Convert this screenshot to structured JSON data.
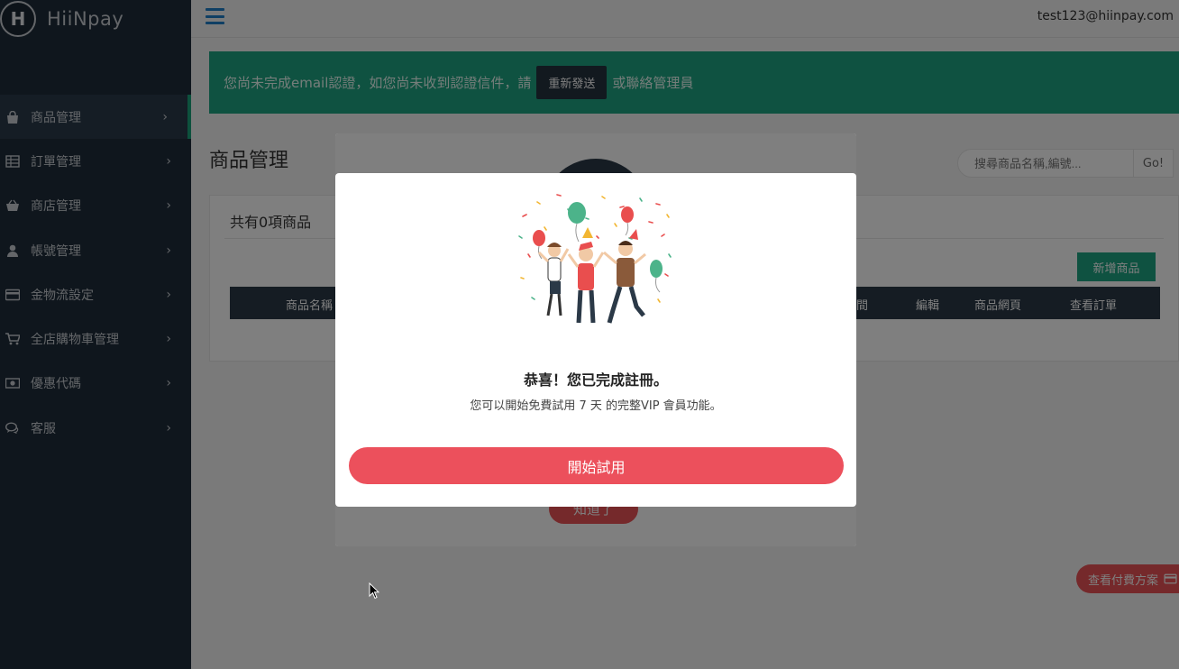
{
  "app": {
    "logo_letter": "H",
    "name": "HiiNpay"
  },
  "topbar": {
    "user_email": "test123@hiinpay.com"
  },
  "sidebar": {
    "items": [
      {
        "label": "商品管理",
        "icon": "shopping-bag-icon",
        "active": true
      },
      {
        "label": "訂單管理",
        "icon": "table-icon"
      },
      {
        "label": "商店管理",
        "icon": "basket-icon"
      },
      {
        "label": "帳號管理",
        "icon": "user-icon"
      },
      {
        "label": "金物流設定",
        "icon": "credit-card-icon"
      },
      {
        "label": "全店購物車管理",
        "icon": "cart-icon"
      },
      {
        "label": "優惠代碼",
        "icon": "money-icon"
      },
      {
        "label": "客服",
        "icon": "chat-icon"
      }
    ]
  },
  "alert": {
    "text_before": "您尚未完成email認證，如您尚未收到認證信件，請",
    "resend_label": "重新發送",
    "text_after": "或聯絡管理員"
  },
  "page": {
    "title": "商品管理"
  },
  "search": {
    "placeholder": "搜尋商品名稱,編號...",
    "go_label": "Go!"
  },
  "products_panel": {
    "count_text": "共有0項商品",
    "add_label": "新增商品",
    "columns": [
      "商品名稱",
      "間",
      "編輯",
      "商品網頁",
      "查看訂單"
    ]
  },
  "plan_button": {
    "label": "查看付費方案"
  },
  "back_modal": {
    "button_label": "知道了"
  },
  "modal": {
    "title": "恭喜！您已完成註冊。",
    "subtitle": "您可以開始免費試用 7 天 的完整VIP 會員功能。",
    "start_label": "開始試用"
  },
  "colors": {
    "sidebar_bg": "#1f2d3b",
    "accent_green": "#1fa583",
    "accent_red": "#ec505c",
    "hamburger_blue": "#1e7ec8"
  }
}
